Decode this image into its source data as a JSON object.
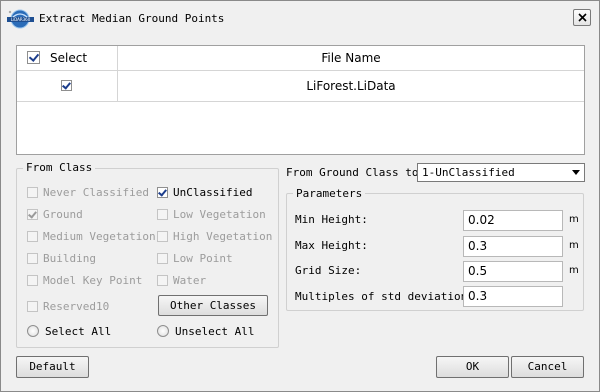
{
  "window": {
    "title": "Extract Median Ground Points",
    "logo_text": "LiDAR360"
  },
  "file_table": {
    "columns": [
      "Select",
      "File Name"
    ],
    "header_select_checked": true,
    "rows": [
      {
        "selected": true,
        "file_name": "LiForest.LiData"
      }
    ]
  },
  "from_class": {
    "legend": "From Class",
    "items": [
      {
        "label": "Never Classified",
        "checked": false,
        "enabled": false
      },
      {
        "label": "UnClassified",
        "checked": true,
        "enabled": true
      },
      {
        "label": "Ground",
        "checked": true,
        "enabled": false
      },
      {
        "label": "Low Vegetation",
        "checked": false,
        "enabled": false
      },
      {
        "label": "Medium Vegetation",
        "checked": false,
        "enabled": false
      },
      {
        "label": "High Vegetation",
        "checked": false,
        "enabled": false
      },
      {
        "label": "Building",
        "checked": false,
        "enabled": false
      },
      {
        "label": "Low Point",
        "checked": false,
        "enabled": false
      },
      {
        "label": "Model Key Point",
        "checked": false,
        "enabled": false
      },
      {
        "label": "Water",
        "checked": false,
        "enabled": false
      },
      {
        "label": "Reserved10",
        "checked": false,
        "enabled": false
      }
    ],
    "other_classes_button": "Other Classes",
    "select_all": "Select All",
    "unselect_all": "Unselect All"
  },
  "ground_class": {
    "label": "From Ground Class to:",
    "value": "1-UnClassified"
  },
  "parameters": {
    "legend": "Parameters",
    "fields": [
      {
        "label": "Min Height:",
        "value": "0.02",
        "unit": "m"
      },
      {
        "label": "Max Height:",
        "value": "0.3",
        "unit": "m"
      },
      {
        "label": "Grid Size:",
        "value": "0.5",
        "unit": "m"
      },
      {
        "label": "Multiples of std deviation:",
        "value": "0.3",
        "unit": ""
      }
    ]
  },
  "buttons": {
    "default": "Default",
    "ok": "OK",
    "cancel": "Cancel"
  },
  "colors": {
    "window_bg": "#f0f0f0",
    "checkmark": "#1c3d8c",
    "disabled_text": "#9c9c9c"
  }
}
